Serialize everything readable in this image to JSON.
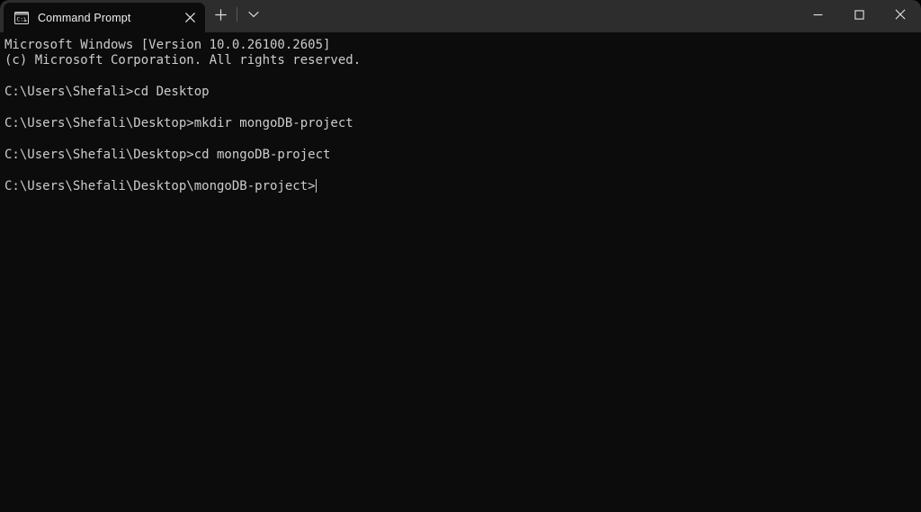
{
  "window": {
    "titlebar_color": "#2d2d2d",
    "terminal_bg": "#0c0c0c",
    "terminal_fg": "#cccccc"
  },
  "tab": {
    "title": "Command Prompt",
    "icon": "command-prompt-icon",
    "close_label": "Close tab"
  },
  "tabstrip": {
    "new_tab_label": "+",
    "dropdown_label": "v"
  },
  "window_controls": {
    "minimize_label": "Minimize",
    "maximize_label": "Maximize",
    "close_label": "Close"
  },
  "terminal": {
    "lines": [
      "Microsoft Windows [Version 10.0.26100.2605]",
      "(c) Microsoft Corporation. All rights reserved.",
      "",
      "C:\\Users\\Shefali>cd Desktop",
      "",
      "C:\\Users\\Shefali\\Desktop>mkdir mongoDB-project",
      "",
      "C:\\Users\\Shefali\\Desktop>cd mongoDB-project",
      "",
      "C:\\Users\\Shefali\\Desktop\\mongoDB-project>"
    ],
    "prompt_current": "C:\\Users\\Shefali\\Desktop\\mongoDB-project>",
    "cursor_visible": true
  }
}
